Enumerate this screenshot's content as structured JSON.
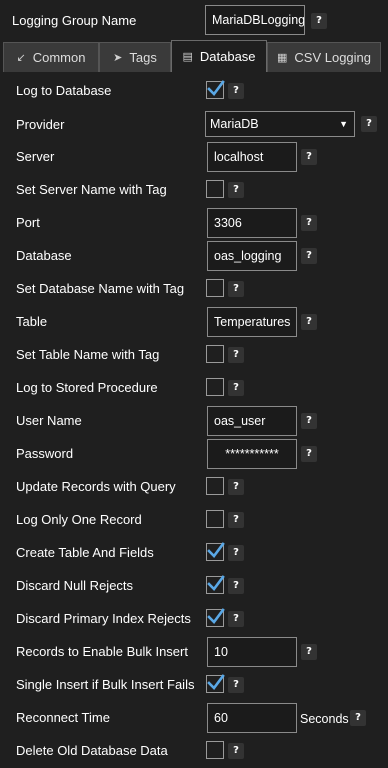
{
  "header": {
    "label": "Logging Group Name",
    "value": "MariaDBLogging",
    "help": "?"
  },
  "tabs": [
    {
      "label": "Common",
      "icon": "arrow-icon",
      "glyph": "↙"
    },
    {
      "label": "Tags",
      "icon": "tag-icon",
      "glyph": "➤"
    },
    {
      "label": "Database",
      "icon": "database-icon",
      "glyph": "▤",
      "active": true
    },
    {
      "label": "CSV Logging",
      "icon": "csv-file-icon",
      "glyph": "▦"
    }
  ],
  "fields": {
    "log_to_database": {
      "label": "Log to Database",
      "checked": true
    },
    "provider": {
      "label": "Provider",
      "value": "MariaDB"
    },
    "server": {
      "label": "Server",
      "value": "localhost"
    },
    "set_server_name_with_tag": {
      "label": "Set Server Name with Tag",
      "checked": false
    },
    "port": {
      "label": "Port",
      "value": "3306"
    },
    "database": {
      "label": "Database",
      "value": "oas_logging"
    },
    "set_database_name_with_tag": {
      "label": "Set Database Name with Tag",
      "checked": false
    },
    "table": {
      "label": "Table",
      "value": "Temperatures"
    },
    "set_table_name_with_tag": {
      "label": "Set Table Name with Tag",
      "checked": false
    },
    "log_to_stored_procedure": {
      "label": "Log to Stored Procedure",
      "checked": false
    },
    "user_name": {
      "label": "User Name",
      "value": "oas_user"
    },
    "password": {
      "label": "Password",
      "value": "***********"
    },
    "update_records_with_query": {
      "label": "Update Records with Query",
      "checked": false
    },
    "log_only_one_record": {
      "label": "Log Only One Record",
      "checked": false
    },
    "create_table_and_fields": {
      "label": "Create Table And Fields",
      "checked": true
    },
    "discard_null_rejects": {
      "label": "Discard Null Rejects",
      "checked": true
    },
    "discard_primary_index_rejects": {
      "label": "Discard Primary Index Rejects",
      "checked": true
    },
    "records_to_enable_bulk_insert": {
      "label": "Records to Enable Bulk Insert",
      "value": "10"
    },
    "single_insert_if_bulk_insert_fails": {
      "label": "Single Insert if Bulk Insert Fails",
      "checked": true
    },
    "reconnect_time": {
      "label": "Reconnect Time",
      "value": "60",
      "unit": "Seconds"
    },
    "delete_old_database_data": {
      "label": "Delete Old Database Data",
      "checked": false
    }
  },
  "help_label": "?",
  "colors": {
    "background": "#1f1f1f",
    "check": "#5aa8e6",
    "tab_inactive": "#3a3a3a"
  }
}
